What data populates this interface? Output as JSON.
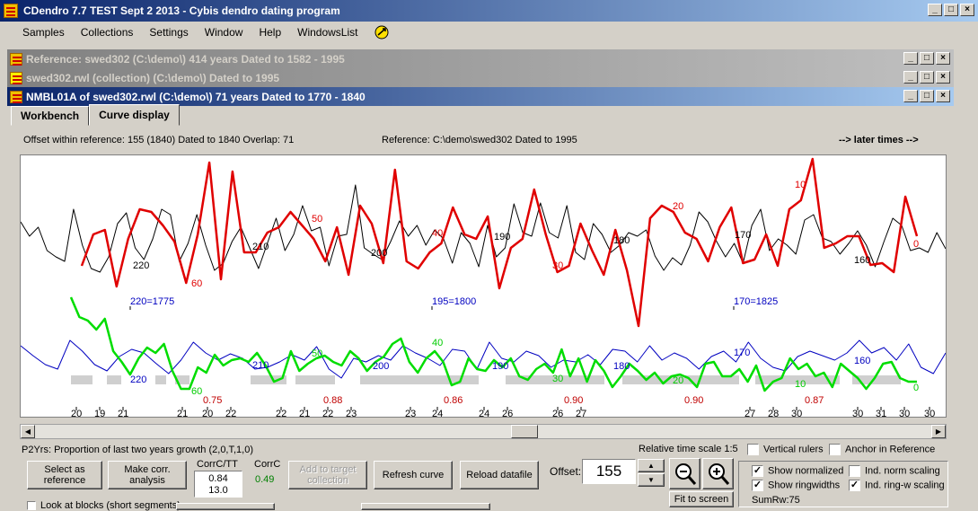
{
  "app": {
    "title": "CDendro 7.7 TEST Sept 2 2013 - Cybis dendro dating program"
  },
  "menu": [
    "Samples",
    "Collections",
    "Settings",
    "Window",
    "Help",
    "WindowsList"
  ],
  "windows": [
    {
      "title": "Reference: swed302    (C:\\demo\\)  414 years  Dated to 1582 - 1995"
    },
    {
      "title": "swed302.rwl (collection)  (C:\\demo\\) Dated to 1995"
    },
    {
      "title": "NMBL01A of swed302.rwl    (C:\\demo\\)  71 years  Dated to 1770 - 1840"
    }
  ],
  "tabs": [
    "Workbench",
    "Curve display"
  ],
  "info": {
    "offset_line": "Offset within reference:   155  (1840)   Dated to 1840  Overlap: 71",
    "reference_line": "Reference: C:\\demo\\swed302  Dated to 1995",
    "later_times": "--> later times -->"
  },
  "chart_data": {
    "type": "line",
    "series": [
      {
        "color": "#000000",
        "values": [
          246,
          262,
          252,
          278,
          285,
          290,
          232,
          272,
          298,
          302,
          285,
          248,
          236,
          275,
          288,
          265,
          232,
          238,
          290,
          270,
          238,
          272,
          300,
          292,
          268,
          252,
          275,
          298,
          270,
          242,
          278,
          260,
          228,
          256,
          252,
          295,
          262,
          260,
          205,
          275,
          282,
          288,
          268,
          245,
          262,
          250,
          272,
          255,
          265,
          292,
          258,
          270,
          296,
          250,
          285,
          275,
          226,
          258,
          262,
          225,
          258,
          264,
          228,
          280,
          288,
          248,
          260,
          280,
          272,
          258,
          262,
          255,
          284,
          300,
          286,
          294,
          272,
          235,
          246,
          268,
          285,
          270,
          292,
          250,
          232,
          278,
          265,
          272,
          282,
          244,
          238,
          264,
          268,
          282,
          270,
          256,
          272,
          296,
          268,
          242,
          250,
          278,
          275,
          280,
          258,
          276
        ]
      },
      {
        "color": "#e00000",
        "values": [
          295,
          260,
          255,
          318,
          265,
          232,
          235,
          250,
          268,
          314,
          260,
          180,
          310,
          190,
          280,
          280,
          258,
          252,
          235,
          250,
          265,
          290,
          252,
          305,
          228,
          248,
          292,
          188,
          290,
          298,
          280,
          270,
          230,
          260,
          265,
          240,
          320,
          275,
          265,
          210,
          260,
          302,
          295,
          248,
          278,
          305,
          255,
          300,
          362,
          242,
          228,
          235,
          258,
          265,
          290,
          252,
          230,
          292,
          288,
          260,
          295,
          232,
          222,
          176,
          275,
          270,
          262,
          262,
          294,
          292,
          302,
          218,
          262
        ]
      },
      {
        "color": "#0000c0",
        "values": [
          384,
          395,
          405,
          410,
          378,
          390,
          405,
          412,
          396,
          388,
          392,
          404,
          415,
          400,
          380,
          392,
          400,
          393,
          398,
          410,
          408,
          402,
          394,
          400,
          385,
          410,
          420,
          398,
          402,
          395,
          400,
          384,
          392,
          398,
          406,
          388,
          390,
          410,
          380,
          398,
          402,
          390,
          395,
          408,
          400,
          402,
          394,
          405,
          388,
          390,
          402,
          384,
          400,
          392,
          398,
          410,
          396,
          390,
          402,
          380,
          398,
          408,
          412,
          396,
          390,
          395,
          400,
          392,
          378,
          392,
          386,
          400,
          382,
          408,
          415,
          392
        ]
      },
      {
        "color": "#00dd00",
        "values": [
          330,
          352,
          356,
          366,
          354,
          390,
          402,
          416,
          398,
          386,
          392,
          382,
          412,
          432,
          432,
          408,
          414,
          394,
          406,
          400,
          398,
          402,
          392,
          406,
          424,
          420,
          390,
          412,
          404,
          398,
          395,
          402,
          406,
          390,
          398,
          412,
          402,
          396,
          382,
          376,
          402,
          414,
          398,
          390,
          402,
          428,
          424,
          398,
          410,
          412,
          400,
          408,
          398,
          418,
          422,
          410,
          404,
          414,
          388,
          418,
          398,
          424,
          400,
          412,
          430,
          418,
          404,
          412,
          422,
          414,
          426,
          418,
          416,
          420,
          430,
          404,
          402,
          418,
          418,
          410,
          424,
          406,
          434,
          424,
          420,
          398,
          410,
          404,
          418,
          414,
          430,
          404,
          412,
          420,
          432,
          420,
          404,
          402,
          420,
          424,
          424
        ]
      }
    ],
    "annotations": {
      "black_marks": [
        "220",
        "210",
        "200",
        "190",
        "180",
        "170",
        "160"
      ],
      "red_marks": [
        "60",
        "50",
        "40",
        "30",
        "20",
        "10",
        "0"
      ],
      "blue_marks": [
        "220=1775",
        "195=1800",
        "170=1825"
      ],
      "lower_blue_marks": [
        "220",
        "210",
        "200",
        "190",
        "180",
        "170",
        "160"
      ],
      "lower_green_marks": [
        "60",
        "50",
        "40",
        "30",
        "20",
        "10",
        "0"
      ],
      "corr_values": [
        "0.75",
        "0.88",
        "0.86",
        "0.90",
        "0.90",
        "0.87"
      ],
      "axis_ticks": [
        "20",
        "19",
        "21",
        "21",
        "20",
        "22",
        "22",
        "21",
        "22",
        "23",
        "23",
        "24",
        "24",
        "26",
        "26",
        "27",
        "27",
        "28",
        "30",
        "30",
        "31",
        "30",
        "30"
      ]
    }
  },
  "controls": {
    "p2yrs": "P2Yrs: Proportion of last two years growth (2,0,T,1,0)",
    "time_scale": "Relative time scale 1:5",
    "vertical_rulers": "Vertical rulers",
    "anchor": "Anchor in Reference",
    "select_ref": "Select as reference",
    "make_corr": "Make corr. analysis",
    "corrc_tt_label": "CorrC/TT",
    "corrc_tt_1": "0.84",
    "corrc_tt_2": "13.0",
    "corrc_label": "CorrC",
    "corrc_val": "0.49",
    "add_target": "Add to target collection",
    "refresh": "Refresh curve",
    "reload": "Reload datafile",
    "offset_label": "Offset:",
    "offset_value": "155",
    "fit_screen": "Fit to screen",
    "show_norm": "Show normalized",
    "ind_norm": "Ind. norm scaling",
    "show_ring": "Show ringwidths",
    "ind_ring": "Ind. ring-w scaling",
    "sumrw": "SumRw:75",
    "look_blocks": "Look at blocks (short segments)"
  }
}
